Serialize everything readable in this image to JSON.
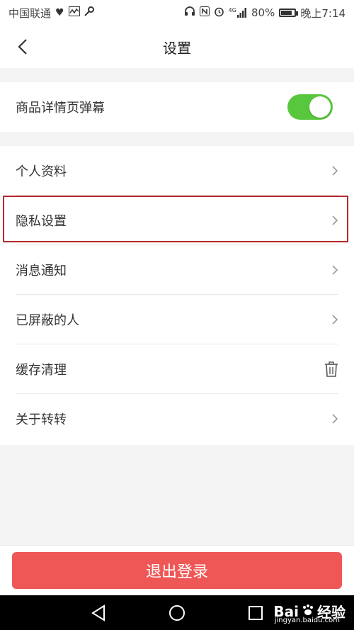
{
  "status_bar": {
    "carrier": "中国联通",
    "battery": "80%",
    "battery_level": 0.8,
    "network": "4G",
    "time": "晚上7:14"
  },
  "nav": {
    "title": "设置"
  },
  "settings": {
    "toggle_row": {
      "label": "商品详情页弹幕",
      "enabled": true
    },
    "items": [
      {
        "label": "个人资料",
        "icon": "chevron-right-icon"
      },
      {
        "label": "隐私设置",
        "icon": "chevron-right-icon"
      },
      {
        "label": "消息通知",
        "icon": "chevron-right-icon"
      },
      {
        "label": "已屏蔽的人",
        "icon": "chevron-right-icon"
      },
      {
        "label": "缓存清理",
        "icon": "trash-icon"
      },
      {
        "label": "关于转转",
        "icon": "chevron-right-icon"
      }
    ]
  },
  "footer": {
    "logout_label": "退出登录"
  },
  "watermark": {
    "brand": "Bai",
    "suffix": "经验",
    "url": "jingyan.baidu.com"
  },
  "colors": {
    "toggle_on": "#59c73d",
    "logout": "#ef5757",
    "highlight": "#b5282b"
  }
}
